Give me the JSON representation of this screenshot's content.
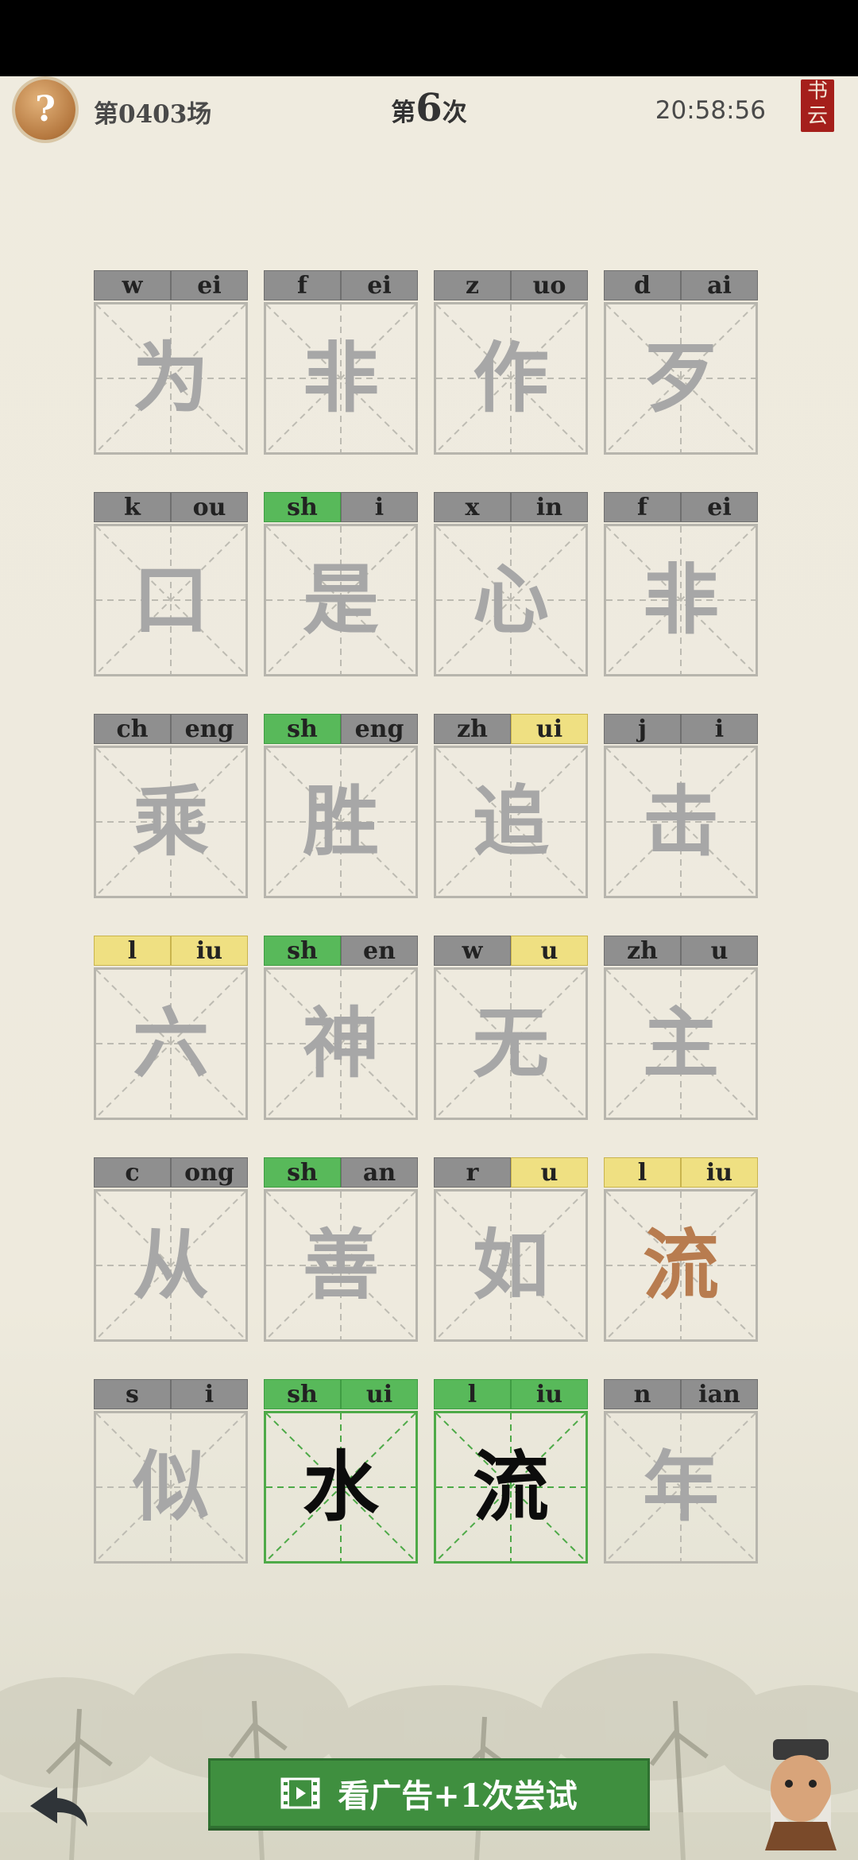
{
  "header": {
    "help_icon": "question-mark-icon",
    "help_symbol": "?",
    "round_label": "第0403场",
    "attempt_prefix": "第",
    "attempt_number": "6",
    "attempt_suffix": "次",
    "clock": "20:58:56",
    "logo_text_top": "书",
    "logo_text_bottom": "云"
  },
  "grid": {
    "rows": [
      [
        {
          "initial": "w",
          "final": "ei",
          "char": "为",
          "initial_status": "gray",
          "final_status": "gray",
          "char_status": "unrevealed"
        },
        {
          "initial": "f",
          "final": "ei",
          "char": "非",
          "initial_status": "gray",
          "final_status": "gray",
          "char_status": "unrevealed"
        },
        {
          "initial": "z",
          "final": "uo",
          "char": "作",
          "initial_status": "gray",
          "final_status": "gray",
          "char_status": "unrevealed"
        },
        {
          "initial": "d",
          "final": "ai",
          "char": "歹",
          "initial_status": "gray",
          "final_status": "gray",
          "char_status": "unrevealed"
        }
      ],
      [
        {
          "initial": "k",
          "final": "ou",
          "char": "口",
          "initial_status": "gray",
          "final_status": "gray",
          "char_status": "unrevealed"
        },
        {
          "initial": "sh",
          "final": "i",
          "char": "是",
          "initial_status": "green",
          "final_status": "gray",
          "char_status": "unrevealed"
        },
        {
          "initial": "x",
          "final": "in",
          "char": "心",
          "initial_status": "gray",
          "final_status": "gray",
          "char_status": "unrevealed"
        },
        {
          "initial": "f",
          "final": "ei",
          "char": "非",
          "initial_status": "gray",
          "final_status": "gray",
          "char_status": "unrevealed"
        }
      ],
      [
        {
          "initial": "ch",
          "final": "eng",
          "char": "乘",
          "initial_status": "gray",
          "final_status": "gray",
          "char_status": "unrevealed"
        },
        {
          "initial": "sh",
          "final": "eng",
          "char": "胜",
          "initial_status": "green",
          "final_status": "gray",
          "char_status": "unrevealed"
        },
        {
          "initial": "zh",
          "final": "ui",
          "char": "追",
          "initial_status": "gray",
          "final_status": "yellow",
          "char_status": "unrevealed"
        },
        {
          "initial": "j",
          "final": "i",
          "char": "击",
          "initial_status": "gray",
          "final_status": "gray",
          "char_status": "unrevealed"
        }
      ],
      [
        {
          "initial": "l",
          "final": "iu",
          "char": "六",
          "initial_status": "yellow",
          "final_status": "yellow",
          "char_status": "unrevealed"
        },
        {
          "initial": "sh",
          "final": "en",
          "char": "神",
          "initial_status": "green",
          "final_status": "gray",
          "char_status": "unrevealed"
        },
        {
          "initial": "w",
          "final": "u",
          "char": "无",
          "initial_status": "gray",
          "final_status": "yellow",
          "char_status": "unrevealed"
        },
        {
          "initial": "zh",
          "final": "u",
          "char": "主",
          "initial_status": "gray",
          "final_status": "gray",
          "char_status": "unrevealed"
        }
      ],
      [
        {
          "initial": "c",
          "final": "ong",
          "char": "从",
          "initial_status": "gray",
          "final_status": "gray",
          "char_status": "unrevealed"
        },
        {
          "initial": "sh",
          "final": "an",
          "char": "善",
          "initial_status": "green",
          "final_status": "gray",
          "char_status": "unrevealed"
        },
        {
          "initial": "r",
          "final": "u",
          "char": "如",
          "initial_status": "gray",
          "final_status": "yellow",
          "char_status": "unrevealed"
        },
        {
          "initial": "l",
          "final": "iu",
          "char": "流",
          "initial_status": "yellow",
          "final_status": "yellow",
          "char_status": "present"
        }
      ],
      [
        {
          "initial": "s",
          "final": "i",
          "char": "似",
          "initial_status": "gray",
          "final_status": "gray",
          "char_status": "unrevealed"
        },
        {
          "initial": "sh",
          "final": "ui",
          "char": "水",
          "initial_status": "green",
          "final_status": "green",
          "char_status": "correct"
        },
        {
          "initial": "l",
          "final": "iu",
          "char": "流",
          "initial_status": "green",
          "final_status": "green",
          "char_status": "correct"
        },
        {
          "initial": "n",
          "final": "ian",
          "char": "年",
          "initial_status": "gray",
          "final_status": "gray",
          "char_status": "unrevealed"
        }
      ]
    ]
  },
  "footer": {
    "back_icon": "back-arrow-icon",
    "ad_button_icon": "video-film-icon",
    "ad_button_label": "看广告+1次尝试",
    "avatar_icon": "sage-avatar-icon"
  },
  "colors": {
    "green": "#58b95a",
    "yellow": "#efe082",
    "gray": "#8f8f8f",
    "present_char": "#b87c4f",
    "correct_char": "#0c0c0c",
    "unrevealed_char": "#a7a7a7",
    "ad_button": "#3f8f3f"
  }
}
